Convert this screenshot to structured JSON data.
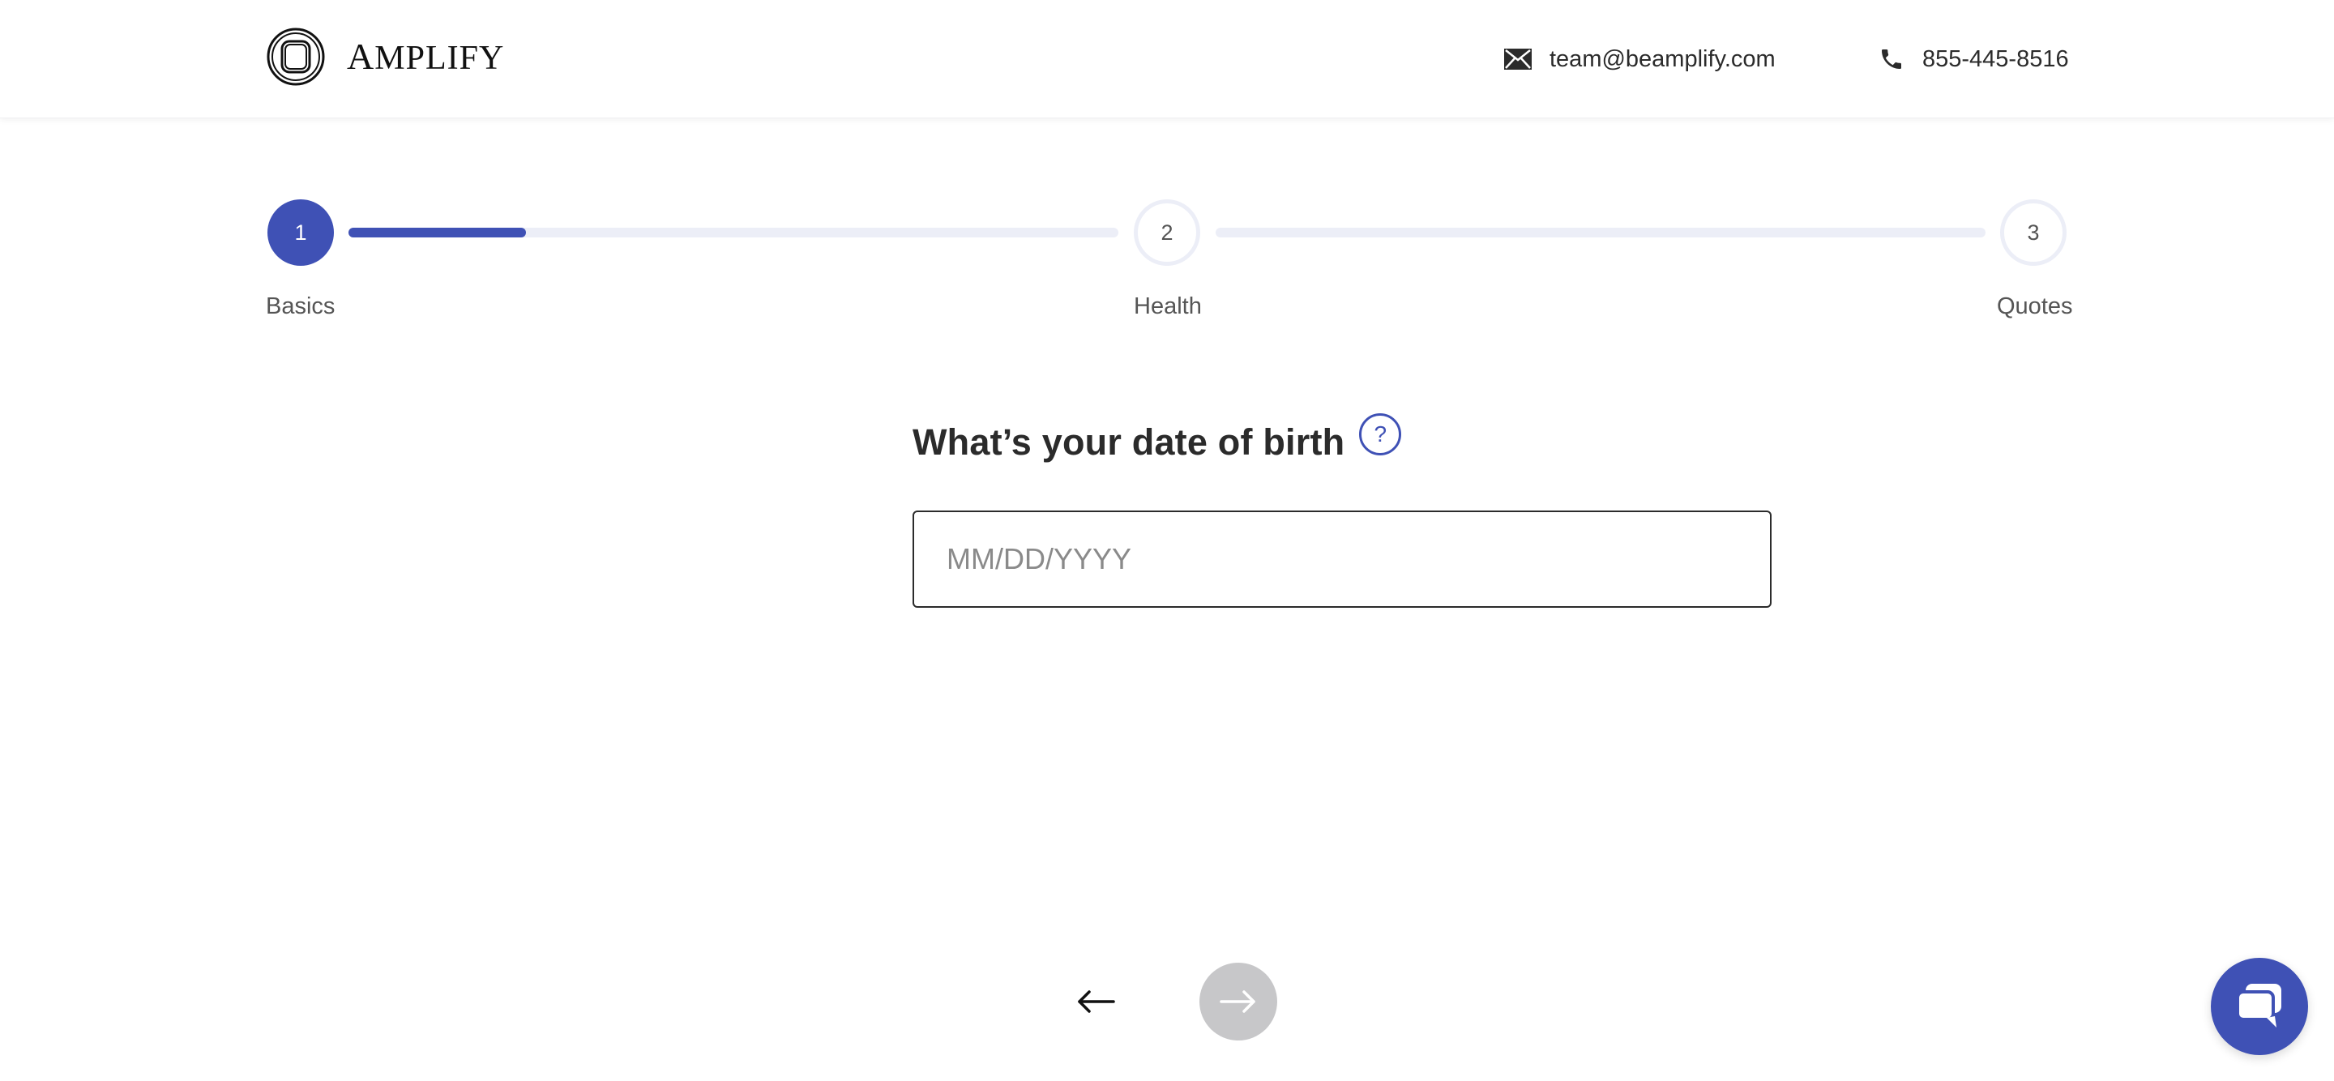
{
  "header": {
    "logo_initial": "A",
    "logo_rest": "MPLIFY",
    "email": "team@beamplify.com",
    "phone": "855-445-8516"
  },
  "stepper": {
    "progress_fraction": 0.23,
    "steps": [
      {
        "number": "1",
        "label": "Basics",
        "state": "active"
      },
      {
        "number": "2",
        "label": "Health",
        "state": "inactive"
      },
      {
        "number": "3",
        "label": "Quotes",
        "state": "inactive"
      }
    ]
  },
  "question": {
    "title": "What’s your date of birth",
    "help_symbol": "?"
  },
  "dob_field": {
    "value": "",
    "placeholder": "MM/DD/YYYY"
  },
  "navigation": {
    "back_icon": "arrow-left-icon",
    "next_icon": "arrow-right-icon",
    "next_enabled": false
  },
  "chat": {
    "icon": "chat-bubbles-icon"
  },
  "colors": {
    "accent": "#3f51b5",
    "track": "#eceef7",
    "disabled": "#c7c7c9",
    "text": "#2b2b2b"
  }
}
